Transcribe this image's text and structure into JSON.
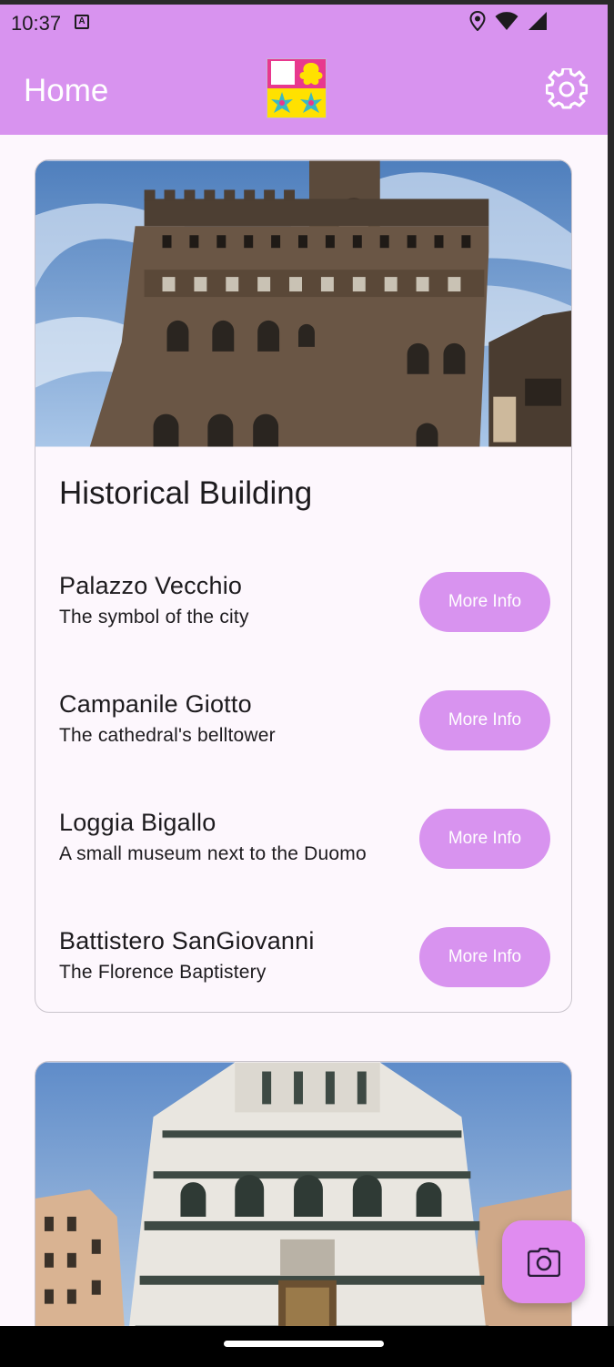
{
  "status_bar": {
    "time": "10:37",
    "notification_icon": "a-icon",
    "icons": [
      "location-icon",
      "wifi-icon",
      "signal-icon"
    ]
  },
  "app_bar": {
    "title": "Home",
    "logo_icon": "app-logo-icon",
    "settings_icon": "gear-icon"
  },
  "colors": {
    "accent": "#d893ef",
    "fab": "#e08cf0",
    "text": "#1d1b1e",
    "background": "#fdf7fd"
  },
  "cards": [
    {
      "image": "palazzo-vecchio-photo",
      "title": "Historical Building",
      "items": [
        {
          "name": "Palazzo Vecchio",
          "description": "The symbol of the city",
          "button": "More Info"
        },
        {
          "name": "Campanile Giotto",
          "description": "The cathedral's belltower",
          "button": "More Info"
        },
        {
          "name": "Loggia Bigallo",
          "description": "A small museum next to the Duomo",
          "button": "More Info"
        },
        {
          "name": "Battistero SanGiovanni",
          "description": "The Florence Baptistery",
          "button": "More Info"
        }
      ]
    },
    {
      "image": "baptistery-photo"
    }
  ],
  "fab": {
    "icon": "camera-icon"
  }
}
